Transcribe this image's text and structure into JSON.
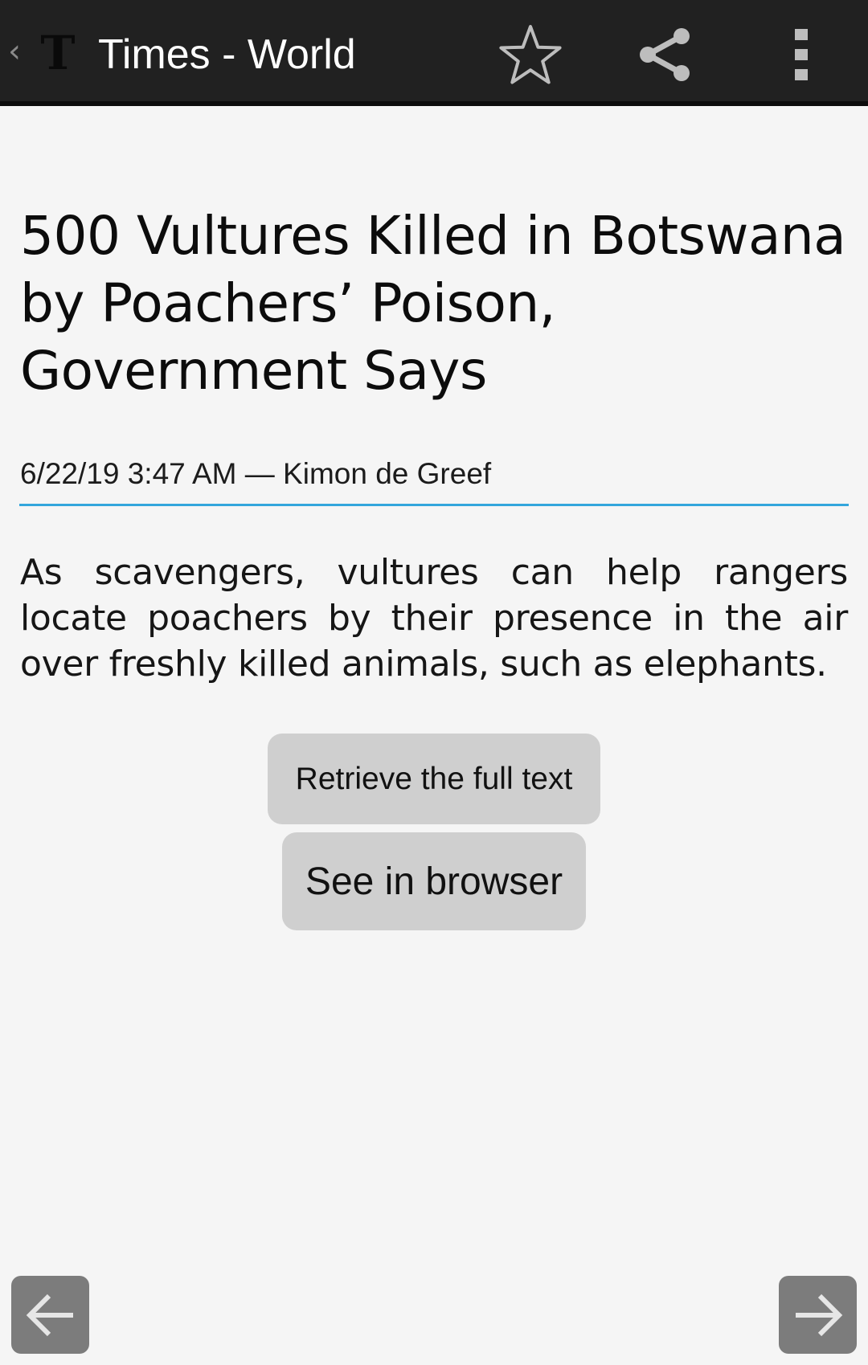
{
  "action_bar": {
    "title": "Times - World",
    "back_glyph": "‹",
    "logo_glyph": "T",
    "icons": {
      "logo": "nyt-logo-icon",
      "star": "star-outline-icon",
      "share": "share-icon",
      "overflow": "overflow-menu-icon"
    }
  },
  "article": {
    "headline": "500 Vultures Killed in Botswana by Poachers’ Poison, Government Says",
    "date": "6/22/19 3:47 AM",
    "separator": " — ",
    "author": "Kimon de Greef",
    "summary": "As scavengers, vultures can help rangers locate poachers by their presence in the air over freshly killed animals, such as elephants."
  },
  "actions": {
    "full_text_label": "Retrieve the full text",
    "browser_label": "See in browser"
  },
  "navigation": {
    "prev_icon": "arrow-left-icon",
    "next_icon": "arrow-right-icon"
  },
  "colors": {
    "action_bar_bg": "#212121",
    "page_bg": "#f5f5f5",
    "divider_accent": "#33a6dc",
    "button_bg": "#cfcfcf",
    "nav_button_bg": "#7c7c7c"
  }
}
